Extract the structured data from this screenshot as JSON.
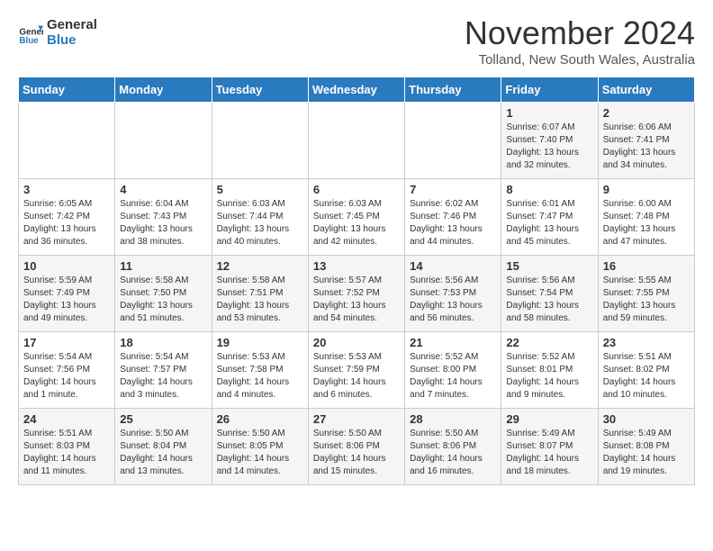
{
  "header": {
    "logo_general": "General",
    "logo_blue": "Blue",
    "month_title": "November 2024",
    "location": "Tolland, New South Wales, Australia"
  },
  "weekdays": [
    "Sunday",
    "Monday",
    "Tuesday",
    "Wednesday",
    "Thursday",
    "Friday",
    "Saturday"
  ],
  "weeks": [
    [
      {
        "day": "",
        "content": ""
      },
      {
        "day": "",
        "content": ""
      },
      {
        "day": "",
        "content": ""
      },
      {
        "day": "",
        "content": ""
      },
      {
        "day": "",
        "content": ""
      },
      {
        "day": "1",
        "content": "Sunrise: 6:07 AM\nSunset: 7:40 PM\nDaylight: 13 hours\nand 32 minutes."
      },
      {
        "day": "2",
        "content": "Sunrise: 6:06 AM\nSunset: 7:41 PM\nDaylight: 13 hours\nand 34 minutes."
      }
    ],
    [
      {
        "day": "3",
        "content": "Sunrise: 6:05 AM\nSunset: 7:42 PM\nDaylight: 13 hours\nand 36 minutes."
      },
      {
        "day": "4",
        "content": "Sunrise: 6:04 AM\nSunset: 7:43 PM\nDaylight: 13 hours\nand 38 minutes."
      },
      {
        "day": "5",
        "content": "Sunrise: 6:03 AM\nSunset: 7:44 PM\nDaylight: 13 hours\nand 40 minutes."
      },
      {
        "day": "6",
        "content": "Sunrise: 6:03 AM\nSunset: 7:45 PM\nDaylight: 13 hours\nand 42 minutes."
      },
      {
        "day": "7",
        "content": "Sunrise: 6:02 AM\nSunset: 7:46 PM\nDaylight: 13 hours\nand 44 minutes."
      },
      {
        "day": "8",
        "content": "Sunrise: 6:01 AM\nSunset: 7:47 PM\nDaylight: 13 hours\nand 45 minutes."
      },
      {
        "day": "9",
        "content": "Sunrise: 6:00 AM\nSunset: 7:48 PM\nDaylight: 13 hours\nand 47 minutes."
      }
    ],
    [
      {
        "day": "10",
        "content": "Sunrise: 5:59 AM\nSunset: 7:49 PM\nDaylight: 13 hours\nand 49 minutes."
      },
      {
        "day": "11",
        "content": "Sunrise: 5:58 AM\nSunset: 7:50 PM\nDaylight: 13 hours\nand 51 minutes."
      },
      {
        "day": "12",
        "content": "Sunrise: 5:58 AM\nSunset: 7:51 PM\nDaylight: 13 hours\nand 53 minutes."
      },
      {
        "day": "13",
        "content": "Sunrise: 5:57 AM\nSunset: 7:52 PM\nDaylight: 13 hours\nand 54 minutes."
      },
      {
        "day": "14",
        "content": "Sunrise: 5:56 AM\nSunset: 7:53 PM\nDaylight: 13 hours\nand 56 minutes."
      },
      {
        "day": "15",
        "content": "Sunrise: 5:56 AM\nSunset: 7:54 PM\nDaylight: 13 hours\nand 58 minutes."
      },
      {
        "day": "16",
        "content": "Sunrise: 5:55 AM\nSunset: 7:55 PM\nDaylight: 13 hours\nand 59 minutes."
      }
    ],
    [
      {
        "day": "17",
        "content": "Sunrise: 5:54 AM\nSunset: 7:56 PM\nDaylight: 14 hours\nand 1 minute."
      },
      {
        "day": "18",
        "content": "Sunrise: 5:54 AM\nSunset: 7:57 PM\nDaylight: 14 hours\nand 3 minutes."
      },
      {
        "day": "19",
        "content": "Sunrise: 5:53 AM\nSunset: 7:58 PM\nDaylight: 14 hours\nand 4 minutes."
      },
      {
        "day": "20",
        "content": "Sunrise: 5:53 AM\nSunset: 7:59 PM\nDaylight: 14 hours\nand 6 minutes."
      },
      {
        "day": "21",
        "content": "Sunrise: 5:52 AM\nSunset: 8:00 PM\nDaylight: 14 hours\nand 7 minutes."
      },
      {
        "day": "22",
        "content": "Sunrise: 5:52 AM\nSunset: 8:01 PM\nDaylight: 14 hours\nand 9 minutes."
      },
      {
        "day": "23",
        "content": "Sunrise: 5:51 AM\nSunset: 8:02 PM\nDaylight: 14 hours\nand 10 minutes."
      }
    ],
    [
      {
        "day": "24",
        "content": "Sunrise: 5:51 AM\nSunset: 8:03 PM\nDaylight: 14 hours\nand 11 minutes."
      },
      {
        "day": "25",
        "content": "Sunrise: 5:50 AM\nSunset: 8:04 PM\nDaylight: 14 hours\nand 13 minutes."
      },
      {
        "day": "26",
        "content": "Sunrise: 5:50 AM\nSunset: 8:05 PM\nDaylight: 14 hours\nand 14 minutes."
      },
      {
        "day": "27",
        "content": "Sunrise: 5:50 AM\nSunset: 8:06 PM\nDaylight: 14 hours\nand 15 minutes."
      },
      {
        "day": "28",
        "content": "Sunrise: 5:50 AM\nSunset: 8:06 PM\nDaylight: 14 hours\nand 16 minutes."
      },
      {
        "day": "29",
        "content": "Sunrise: 5:49 AM\nSunset: 8:07 PM\nDaylight: 14 hours\nand 18 minutes."
      },
      {
        "day": "30",
        "content": "Sunrise: 5:49 AM\nSunset: 8:08 PM\nDaylight: 14 hours\nand 19 minutes."
      }
    ]
  ]
}
